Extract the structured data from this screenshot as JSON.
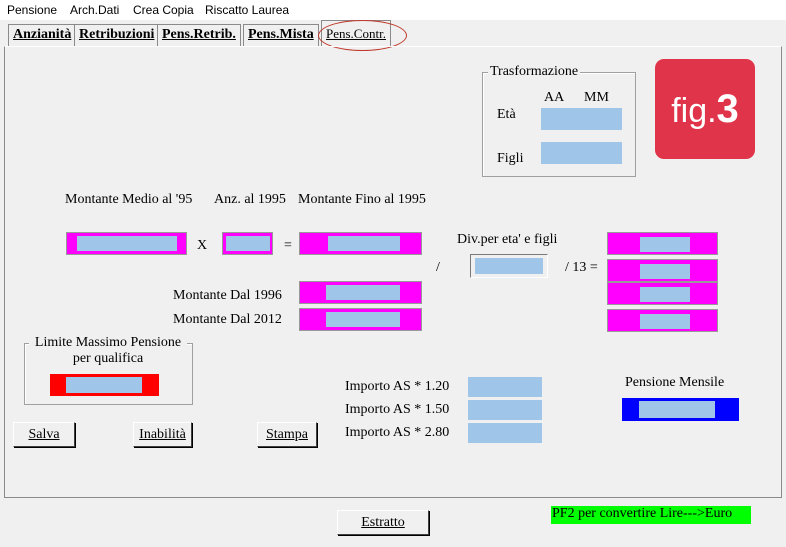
{
  "menu": [
    "Pensione",
    "Arch.Dati",
    "Crea Copia",
    "Riscatto Laurea"
  ],
  "tabs": [
    "Anzianità",
    "Retribuzioni",
    "Pens.Retrib.",
    "Pens.Mista",
    "Pens.Contr."
  ],
  "trasformazione": {
    "title": "Trasformazione",
    "col_aa": "AA",
    "col_mm": "MM",
    "eta": "Età",
    "figli": "Figli"
  },
  "badge": {
    "prefix": "fig.",
    "number": "3"
  },
  "headers": {
    "montante_medio": "Montante Medio al '95",
    "anz": "Anz. al 1995",
    "montante_fino": "Montante Fino al 1995"
  },
  "ops": {
    "times": "X",
    "equals": "=",
    "slash": "/",
    "div13": "/ 13 ="
  },
  "div_label": "Div.per eta' e figli",
  "montante_1996": "Montante Dal 1996",
  "montante_2012": "Montante Dal 2012",
  "limite": {
    "line1": "Limite Massimo Pensione",
    "line2": "per qualifica"
  },
  "importi": [
    "Importo AS * 1.20",
    "Importo AS * 1.50",
    "Importo AS * 2.80"
  ],
  "pensione_mensile": "Pensione Mensile",
  "buttons": {
    "salva": "Salva",
    "inabilita": "Inabilità",
    "stampa": "Stampa",
    "estratto": "Estratto"
  },
  "status": "PF2 per convertire Lire--->Euro",
  "colors": {
    "field_magenta": "#ff00ff",
    "field_blue": "#9fc5e8",
    "limit_red": "#ff0000",
    "pension_blue": "#0000ff",
    "status_green": "#00ff00",
    "badge_red": "#e0344a"
  }
}
